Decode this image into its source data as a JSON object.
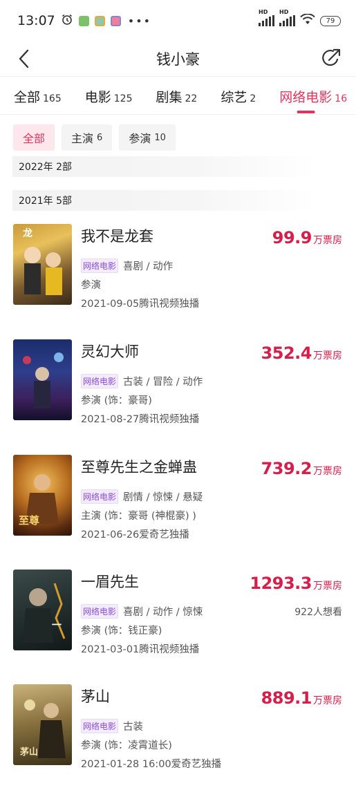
{
  "status_bar": {
    "time": "13:07",
    "hd1": "HD",
    "hd2": "HD",
    "battery": "79"
  },
  "nav": {
    "title": "钱小豪"
  },
  "category_tabs": [
    {
      "label": "全部",
      "count": "165"
    },
    {
      "label": "电影",
      "count": "125"
    },
    {
      "label": "剧集",
      "count": "22"
    },
    {
      "label": "综艺",
      "count": "2"
    },
    {
      "label": "网络电影",
      "count": "16"
    }
  ],
  "filters": [
    {
      "label": "全部",
      "count": ""
    },
    {
      "label": "主演",
      "count": "6"
    },
    {
      "label": "参演",
      "count": "10"
    }
  ],
  "years": [
    {
      "year": "2022年",
      "count": "2部"
    },
    {
      "year": "2021年",
      "count": "5部"
    }
  ],
  "movies": [
    {
      "title": "我不是龙套",
      "tag": "网络电影",
      "genres": "喜剧 / 动作",
      "role": "参演",
      "release": "2021-09-05腾讯视频独播",
      "box": "99.9",
      "box_unit": "万票房",
      "want": ""
    },
    {
      "title": "灵幻大师",
      "tag": "网络电影",
      "genres": "古装 / 冒险 / 动作",
      "role": "参演 (饰：豪哥)",
      "release": "2021-08-27腾讯视频独播",
      "box": "352.4",
      "box_unit": "万票房",
      "want": ""
    },
    {
      "title": "至尊先生之金蝉蛊",
      "tag": "网络电影",
      "genres": "剧情 / 惊悚 / 悬疑",
      "role": "主演 (饰：豪哥 (神棍豪) )",
      "release": "2021-06-26爱奇艺独播",
      "box": "739.2",
      "box_unit": "万票房",
      "want": ""
    },
    {
      "title": "一眉先生",
      "tag": "网络电影",
      "genres": "喜剧 / 动作 / 惊悚",
      "role": "参演 (饰：钱正豪)",
      "release": "2021-03-01腾讯视频独播",
      "box": "1293.3",
      "box_unit": "万票房",
      "want": "922人想看"
    },
    {
      "title": "茅山",
      "tag": "网络电影",
      "genres": "古装",
      "role": "参演 (饰：凌霄道长)",
      "release": "2021-01-28 16:00爱奇艺独播",
      "box": "889.1",
      "box_unit": "万票房",
      "want": ""
    }
  ],
  "colors": {
    "accent": "#e0335e",
    "box_office": "#d51f4a",
    "net_tag": "#8a4dd6"
  }
}
